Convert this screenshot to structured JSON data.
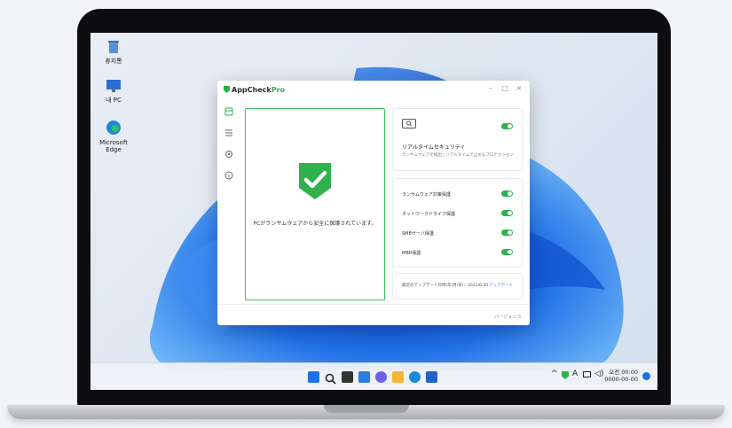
{
  "desktop": {
    "icons": [
      {
        "label": "휴지통",
        "icon": "recycle-bin-icon"
      },
      {
        "label": "내 PC",
        "icon": "monitor-icon"
      },
      {
        "label": "Microsoft Edge",
        "icon": "edge-icon"
      }
    ]
  },
  "app": {
    "name": "AppCheck",
    "edition": "Pro",
    "window_controls": {
      "minimize": "–",
      "maximize": "□",
      "close": "×"
    },
    "sidebar_icons": [
      "dashboard-icon",
      "list-icon",
      "settings-icon",
      "info-icon"
    ],
    "status_message": "PCがランサムウェアから安全に保護されています。",
    "realtime": {
      "title": "リアルタイムセキュリティ",
      "subtitle": "ランサムウェアを検出しリアルタイムで止めるプロテクション"
    },
    "options": [
      {
        "label": "ランサムウェア対策保護",
        "enabled": true
      },
      {
        "label": "ネットワークドライブ保護",
        "enabled": true
      },
      {
        "label": "SMBサーバ保護",
        "enabled": true
      },
      {
        "label": "MBR保護",
        "enabled": true
      }
    ],
    "update": {
      "text": "最近のアップデート日時(年/月/日)：2021/6/30",
      "link": "アップデート"
    },
    "version": "バージョン 3"
  },
  "taskbar": {
    "apps": [
      "windows-start-icon",
      "search-icon",
      "task-view-icon",
      "widgets-icon",
      "chat-icon",
      "file-explorer-icon",
      "edge-icon",
      "store-icon"
    ],
    "tray": {
      "chevron": "^",
      "lang": "A",
      "volume": "◁)"
    },
    "clock": {
      "time": "오전 00:00",
      "date": "0000-00-00"
    }
  },
  "colors": {
    "accent": "#2fb14d",
    "link": "#2f80ed"
  }
}
